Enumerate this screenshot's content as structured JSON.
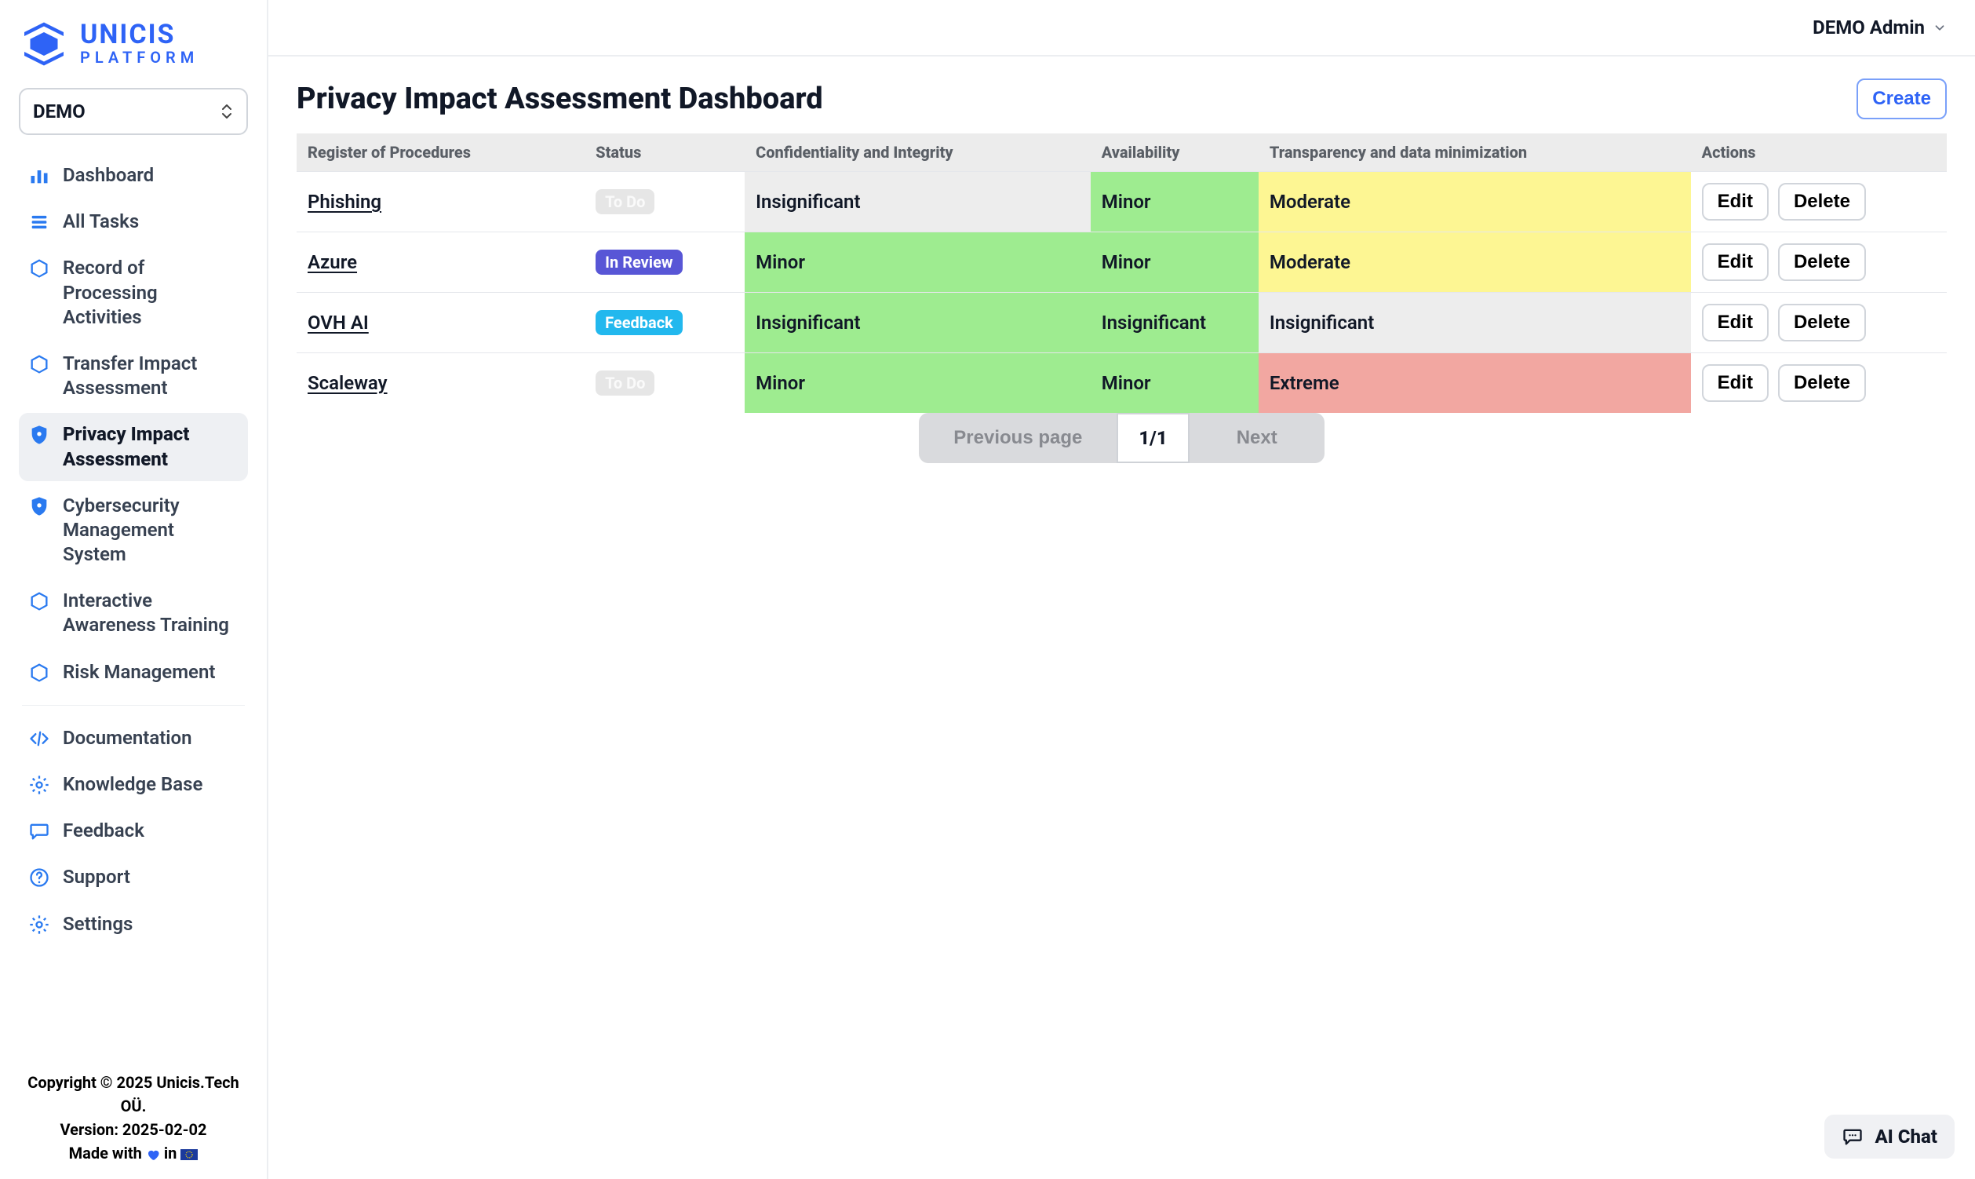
{
  "brand": {
    "line1": "UNICIS",
    "line2": "PLATFORM"
  },
  "team_selector": {
    "label": "DEMO"
  },
  "sidebar": {
    "items": [
      {
        "label": "Dashboard",
        "icon": "bars"
      },
      {
        "label": "All Tasks",
        "icon": "stack"
      },
      {
        "label": "Record of Processing Activities",
        "icon": "cube"
      },
      {
        "label": "Transfer Impact Assessment",
        "icon": "cube"
      },
      {
        "label": "Privacy Impact Assessment",
        "icon": "shield",
        "active": true
      },
      {
        "label": "Cybersecurity Management System",
        "icon": "shield"
      },
      {
        "label": "Interactive Awareness Training",
        "icon": "cube"
      },
      {
        "label": "Risk Management",
        "icon": "cube"
      }
    ],
    "secondary": [
      {
        "label": "Documentation",
        "icon": "code"
      },
      {
        "label": "Knowledge Base",
        "icon": "gear"
      },
      {
        "label": "Feedback",
        "icon": "chat"
      },
      {
        "label": "Support",
        "icon": "help"
      },
      {
        "label": "Settings",
        "icon": "gear"
      }
    ]
  },
  "footer": {
    "copyright": "Copyright © 2025 Unicis.Tech OÜ.",
    "version": "Version: 2025-02-02",
    "madewith_prefix": "Made with ",
    "madewith_mid": " in "
  },
  "topbar": {
    "user": "DEMO Admin"
  },
  "page": {
    "title": "Privacy Impact Assessment Dashboard",
    "create_label": "Create"
  },
  "table": {
    "headers": {
      "register": "Register of Procedures",
      "status": "Status",
      "ci": "Confidentiality and Integrity",
      "availability": "Availability",
      "transparency": "Transparency and data minimization",
      "actions": "Actions"
    },
    "actions": {
      "edit": "Edit",
      "delete": "Delete"
    },
    "status_labels": {
      "todo": "To Do",
      "in_review": "In Review",
      "feedback": "Feedback"
    },
    "rows": [
      {
        "register": "Phishing",
        "status": "todo",
        "ci": {
          "label": "Insignificant",
          "level": "gray"
        },
        "availability": {
          "label": "Minor",
          "level": "green"
        },
        "transparency": {
          "label": "Moderate",
          "level": "yellow"
        }
      },
      {
        "register": "Azure",
        "status": "in_review",
        "ci": {
          "label": "Minor",
          "level": "green"
        },
        "availability": {
          "label": "Minor",
          "level": "green"
        },
        "transparency": {
          "label": "Moderate",
          "level": "yellow"
        }
      },
      {
        "register": "OVH AI",
        "status": "feedback",
        "ci": {
          "label": "Insignificant",
          "level": "green"
        },
        "availability": {
          "label": "Insignificant",
          "level": "green"
        },
        "transparency": {
          "label": "Insignificant",
          "level": "gray"
        }
      },
      {
        "register": "Scaleway",
        "status": "todo",
        "ci": {
          "label": "Minor",
          "level": "green"
        },
        "availability": {
          "label": "Minor",
          "level": "green"
        },
        "transparency": {
          "label": "Extreme",
          "level": "red"
        }
      }
    ]
  },
  "pager": {
    "prev": "Previous page",
    "current": "1/1",
    "next": "Next"
  },
  "fab": {
    "label": "AI Chat"
  }
}
